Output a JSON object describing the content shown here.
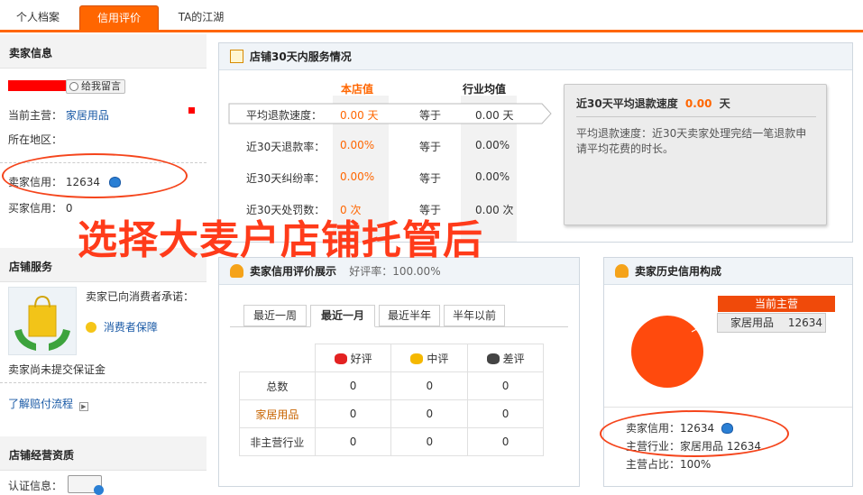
{
  "tabs": {
    "profile": "个人档案",
    "credit": "信用评价",
    "community": "TA的江湖"
  },
  "sidebar": {
    "seller_info_title": "卖家信息",
    "message_button": "给我留言",
    "main_business_label": "当前主营：",
    "main_business_value": "家居用品",
    "region_label": "所在地区：",
    "seller_credit_label": "卖家信用：",
    "seller_credit_value": "12634",
    "buyer_credit_label": "买家信用：",
    "buyer_credit_value": "0",
    "shop_service_title": "店铺服务",
    "promise_text": "卖家已向消费者承诺：",
    "consumer_protection": "消费者保障",
    "deposit_text": "卖家尚未提交保证金",
    "claim_process": "了解赔付流程",
    "qualification_title": "店铺经营资质",
    "certification_label": "认证信息："
  },
  "service": {
    "title": "店铺30天内服务情况",
    "col_shop": "本店值",
    "col_industry": "行业均值",
    "rows": [
      {
        "label": "平均退款速度：",
        "shop": "0.00 天",
        "cmp": "等于",
        "industry": "0.00 天"
      },
      {
        "label": "近30天退款率：",
        "shop": "0.00%",
        "cmp": "等于",
        "industry": "0.00%"
      },
      {
        "label": "近30天纠纷率：",
        "shop": "0.00%",
        "cmp": "等于",
        "industry": "0.00%"
      },
      {
        "label": "近30天处罚数：",
        "shop": "0 次",
        "cmp": "等于",
        "industry": "0.00 次"
      }
    ],
    "tooltip_title_pre": "近30天平均退款速度",
    "tooltip_value": "0.00",
    "tooltip_unit": "天",
    "tooltip_desc": "平均退款速度：近30天卖家处理完结一笔退款申请平均花费的时长。"
  },
  "rating": {
    "title": "卖家信用评价展示",
    "good_rate": "好评率：100.00%",
    "tabs": [
      "最近一周",
      "最近一月",
      "最近半年",
      "半年以前"
    ],
    "headers": [
      "好评",
      "中评",
      "差评"
    ],
    "rows": [
      {
        "label": "总数",
        "good": "0",
        "mid": "0",
        "bad": "0"
      },
      {
        "label": "家居用品",
        "good": "0",
        "mid": "0",
        "bad": "0"
      },
      {
        "label": "非主营行业",
        "good": "0",
        "mid": "0",
        "bad": "0"
      }
    ]
  },
  "history": {
    "title": "卖家历史信用构成",
    "badge": "当前主营",
    "category": "家居用品",
    "category_value": "12634",
    "credit_label": "卖家信用：",
    "credit_value": "12634",
    "industry_label": "主营行业：",
    "industry_value": "家居用品  12634",
    "ratio_label": "主营占比：",
    "ratio_value": "100%",
    "pie_color": "#ff4a0d"
  },
  "overlay_text": "选择大麦户店铺托管后",
  "colors": {
    "accent": "#ff6600",
    "link": "#1a5aa6",
    "annotation": "#f5451c"
  }
}
